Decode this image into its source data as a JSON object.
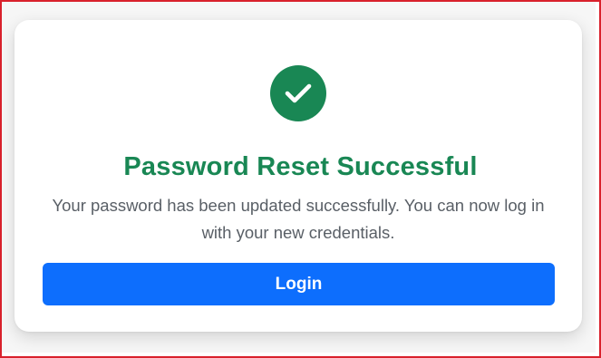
{
  "card": {
    "icon": "check-circle-icon",
    "title": "Password Reset Successful",
    "message": "Your password has been updated successfully. You can now log in with your new credentials.",
    "button_label": "Login"
  },
  "colors": {
    "success": "#198754",
    "primary": "#0d6efd",
    "frame_border": "#d9212c"
  }
}
